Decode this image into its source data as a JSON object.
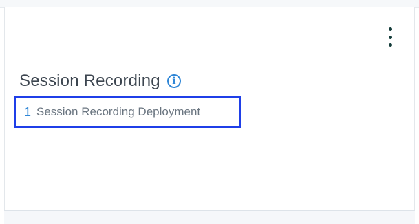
{
  "card": {
    "title": "Session Recording",
    "info_icon": "info-icon",
    "menu_icon": "kebab-menu-icon",
    "deployment": {
      "count": "1",
      "label": "Session Recording Deployment"
    }
  },
  "colors": {
    "accent": "#2f86d6",
    "highlight_border": "#1f3fe8",
    "title_text": "#3d4650",
    "menu_dots": "#143c3a"
  }
}
